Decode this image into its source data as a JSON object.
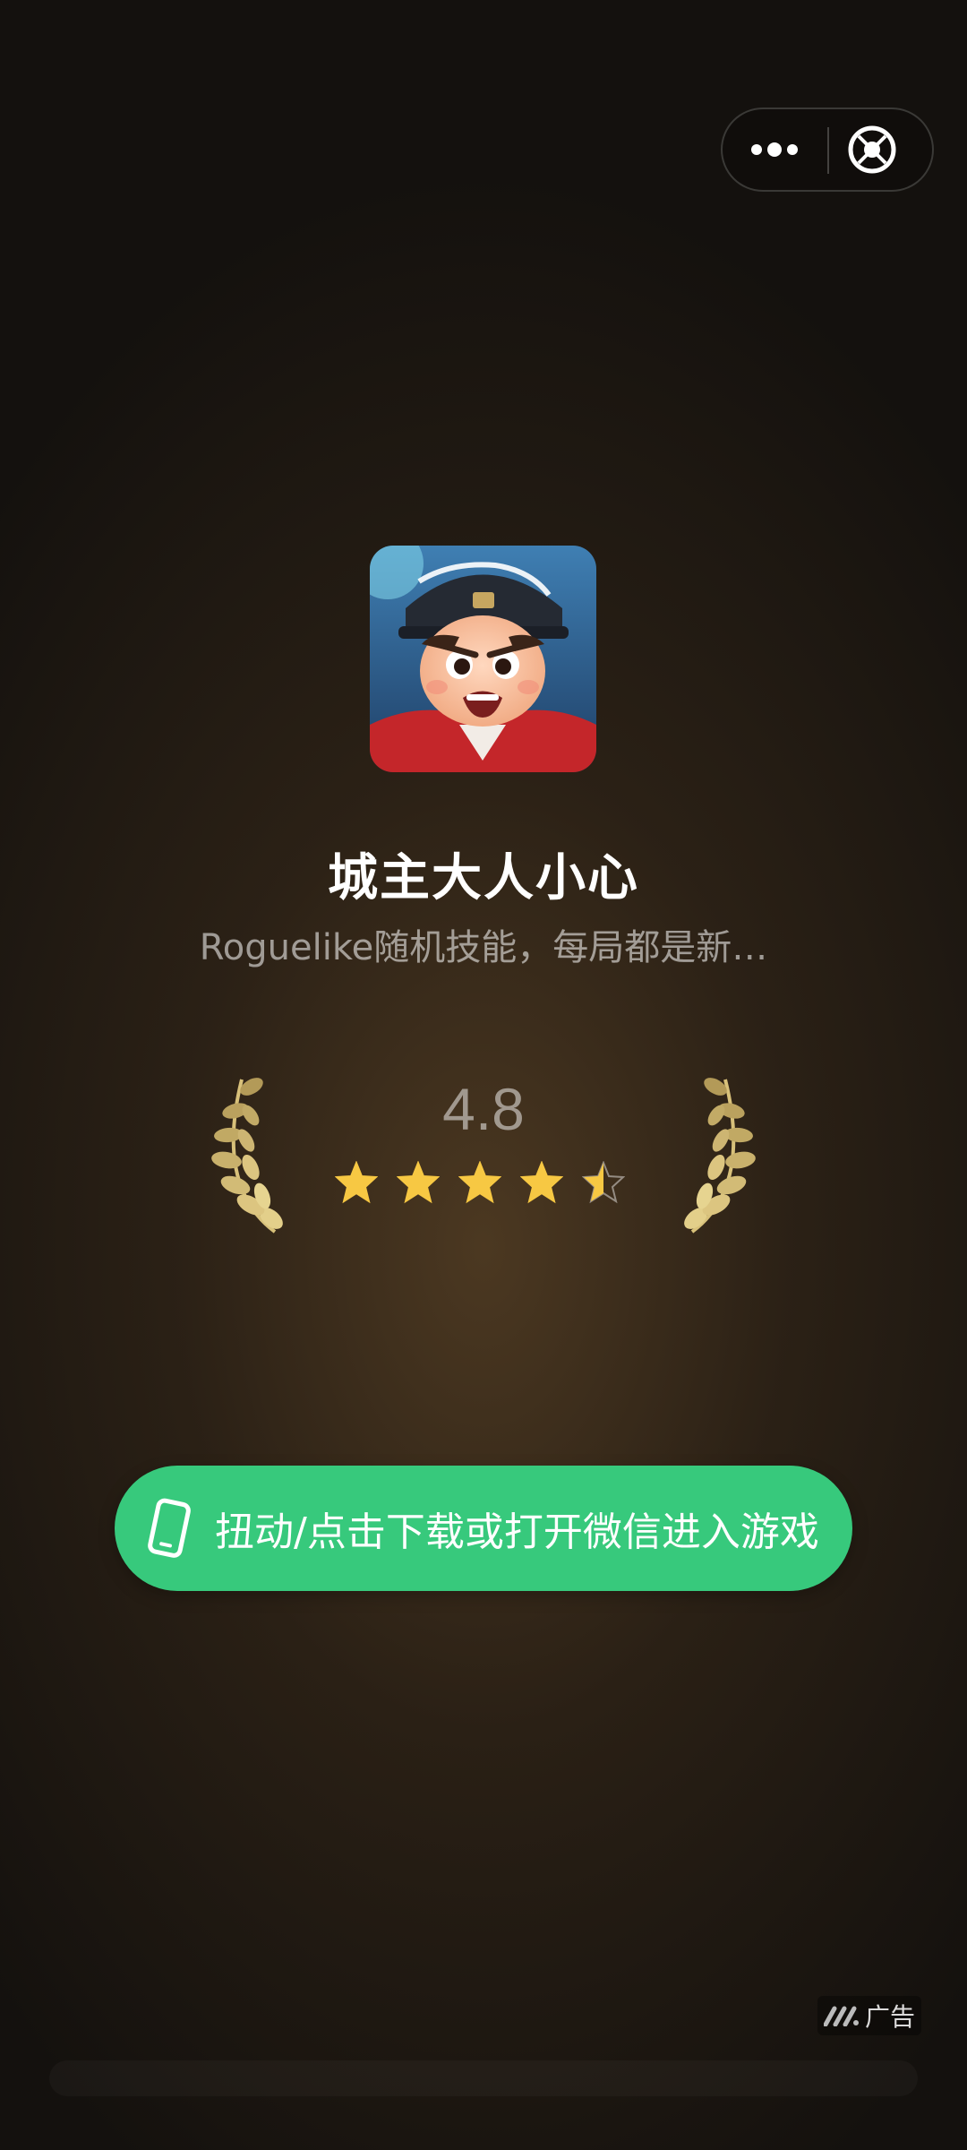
{
  "capsule": {
    "more_icon": "more-dots-icon",
    "close_icon": "close-target-icon"
  },
  "app": {
    "icon": "game-character-icon",
    "title": "城主大人小心",
    "subtitle": "Roguelike随机技能，每局都是新…"
  },
  "rating": {
    "value": "4.8",
    "stars": 4.5,
    "max_stars": 5,
    "star_color": "#f7c843",
    "laurel_color": "#d8c17a"
  },
  "cta": {
    "icon": "phone-icon",
    "label": "扭动/点击下载或打开微信进入游戏",
    "color": "#37c97c"
  },
  "ad": {
    "icon": "ad-brand-icon",
    "label": "广告"
  }
}
